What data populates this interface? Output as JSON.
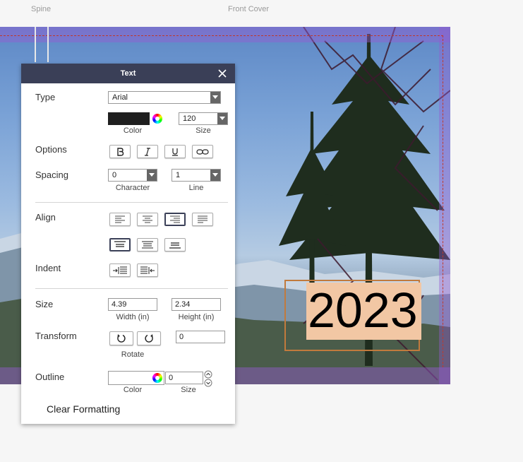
{
  "ruler": {
    "spine": "Spine",
    "front_cover": "Front Cover"
  },
  "cover": {
    "text_box_value": "2023"
  },
  "panel": {
    "title": "Text",
    "type": {
      "label": "Type",
      "font_value": "Arial",
      "color_label": "Color",
      "size_value": "120",
      "size_label": "Size",
      "color_hex": "#1f1f1f"
    },
    "options": {
      "label": "Options"
    },
    "spacing": {
      "label": "Spacing",
      "character_value": "0",
      "character_label": "Character",
      "line_value": "1",
      "line_label": "Line"
    },
    "align": {
      "label": "Align"
    },
    "indent": {
      "label": "Indent"
    },
    "size": {
      "label": "Size",
      "width_value": "4.39",
      "width_label": "Width (in)",
      "height_value": "2.34",
      "height_label": "Height (in)"
    },
    "transform": {
      "label": "Transform",
      "rotate_label": "Rotate",
      "rotate_value": "0"
    },
    "outline": {
      "label": "Outline",
      "color_label": "Color",
      "size_value": "0",
      "size_label": "Size"
    },
    "clear_formatting": "Clear Formatting"
  },
  "colors": {
    "panel_header": "#3a3f57",
    "text_highlight": "#f2c7a4",
    "selection_border": "#c17a3d"
  }
}
